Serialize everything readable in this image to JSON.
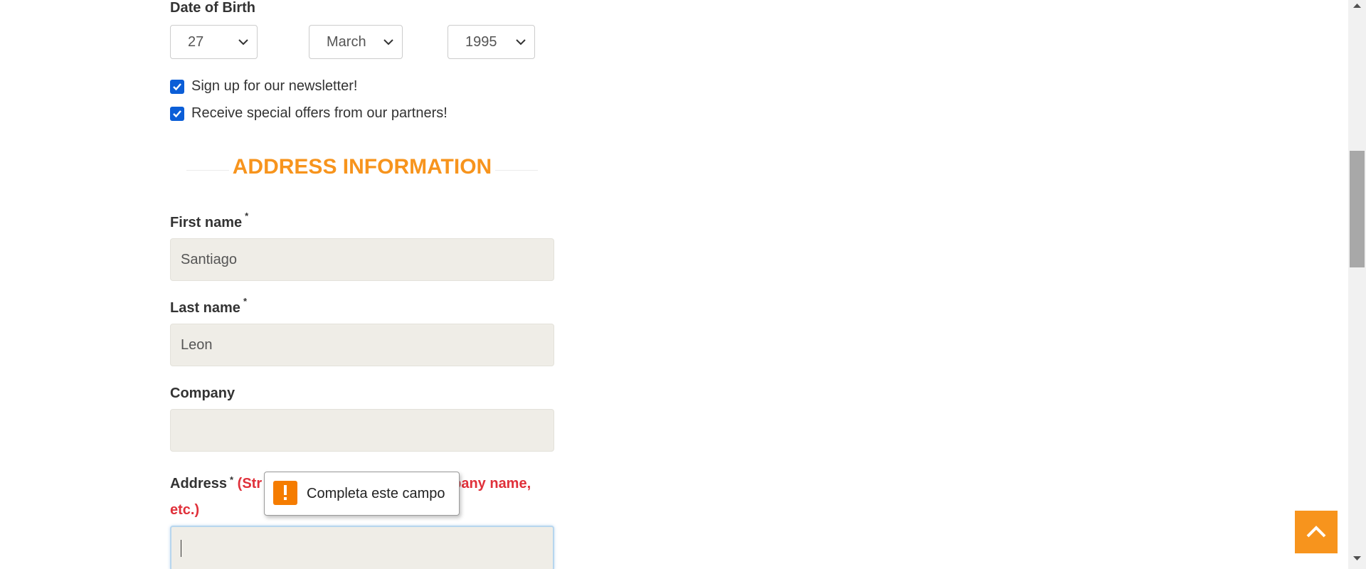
{
  "dob": {
    "label": "Date of Birth",
    "day": "27",
    "month": "March",
    "year": "1995"
  },
  "checkboxes": {
    "newsletter": "Sign up for our newsletter!",
    "offers": "Receive special offers from our partners!"
  },
  "section": {
    "title": "ADDRESS INFORMATION"
  },
  "fields": {
    "first_name_label": "First name",
    "first_name_value": "Santiago",
    "last_name_label": "Last name",
    "last_name_value": "Leon",
    "company_label": "Company",
    "company_value": "",
    "address_label": "Address",
    "address_hint_start": "(Str",
    "address_hint_end": "pany name, etc.)",
    "required_mark": "*"
  },
  "tooltip": {
    "message": "Completa este campo",
    "icon": "warning-icon"
  },
  "colors": {
    "accent": "#f7941d",
    "required_hint": "#e0303a",
    "checkbox": "#0b5ed7",
    "input_bg": "#efede7"
  }
}
